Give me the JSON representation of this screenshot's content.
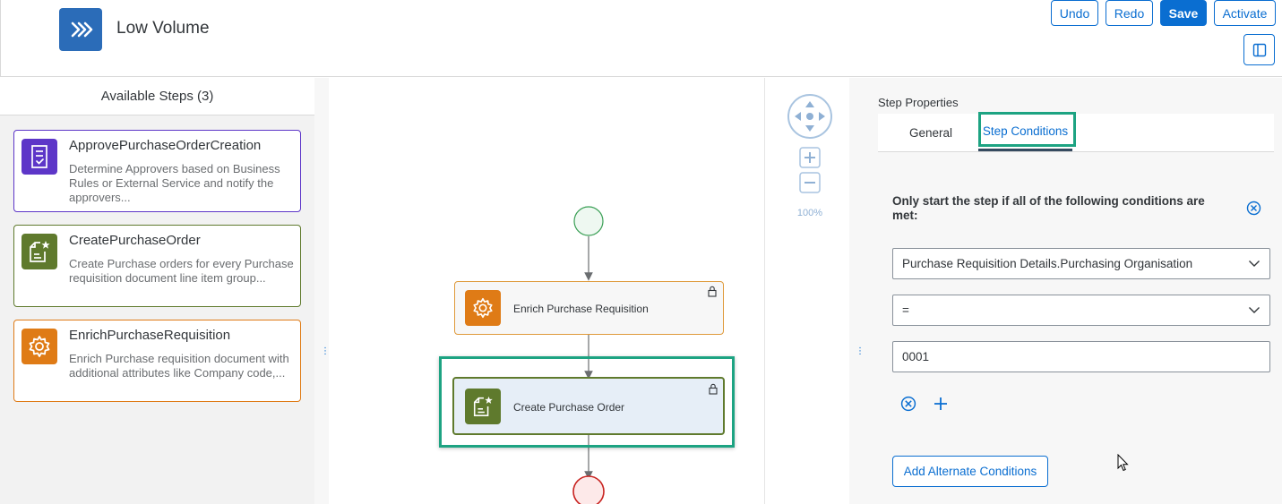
{
  "header": {
    "app_icon": "chevrons-right-icon",
    "title": "Low Volume",
    "buttons": {
      "undo": "Undo",
      "redo": "Redo",
      "save": "Save",
      "activate": "Activate"
    },
    "panel_toggle_icon": "side-panel-icon"
  },
  "left_panel": {
    "title": "Available Steps (3)",
    "steps": [
      {
        "name": "ApprovePurchaseOrderCreation",
        "description": "Determine Approvers based on Business Rules or External Service and notify the approvers...",
        "icon": "approval-document-icon",
        "color": "#5d36c8"
      },
      {
        "name": "CreatePurchaseOrder",
        "description": "Create Purchase orders for every Purchase requisition document line item group...",
        "icon": "create-document-icon",
        "color": "#5f7a2d"
      },
      {
        "name": "EnrichPurchaseRequisition",
        "description": "Enrich Purchase requisition document with additional attributes like Company code,...",
        "icon": "gear-icon",
        "color": "#df7b16"
      }
    ]
  },
  "canvas": {
    "zoom_level": "100%",
    "nodes": {
      "enrich": {
        "label": "Enrich Purchase Requisition",
        "icon": "gear-icon",
        "lock_icon": "lock-icon"
      },
      "create": {
        "label": "Create Purchase Order",
        "icon": "create-document-icon",
        "lock_icon": "lock-icon"
      }
    }
  },
  "right_panel": {
    "title": "Step Properties",
    "tabs": [
      "General",
      "Step Conditions"
    ],
    "active_tab": "Step Conditions",
    "condition_heading": "Only start the step if all of the following conditions are met:",
    "field_value": "Purchase Requisition Details.Purchasing Organisation",
    "operator": "=",
    "value": "0001",
    "add_alternate": "Add Alternate Conditions"
  },
  "colors": {
    "accent": "#0a6ed1",
    "highlight": "#1da382",
    "start": "#3a9f55",
    "end": "#c8221f"
  }
}
